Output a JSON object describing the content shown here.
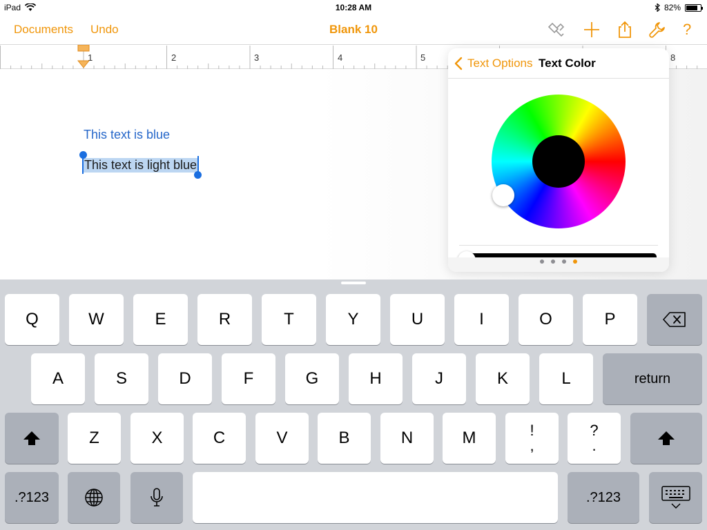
{
  "status_bar": {
    "device": "iPad",
    "time": "10:28 AM",
    "battery_percent": "82%",
    "battery_level": 0.82
  },
  "toolbar": {
    "documents_label": "Documents",
    "undo_label": "Undo",
    "title": "Blank 10",
    "icons": [
      "paintbrush-icon",
      "plus-icon",
      "share-icon",
      "wrench-icon",
      "help-icon"
    ],
    "help_glyph": "?",
    "accent_color": "#f0960a"
  },
  "ruler": {
    "numbers": [
      "1",
      "2",
      "3",
      "4",
      "5",
      "8"
    ]
  },
  "document": {
    "line1": "This text is blue",
    "line2": "This text is light blue",
    "line1_color": "#2667c9",
    "selection_color": "#bcd6f2"
  },
  "popover": {
    "back_label": "Text Options",
    "title": "Text Color",
    "page_count": 4,
    "active_page": 4
  },
  "keyboard": {
    "row1": [
      "Q",
      "W",
      "E",
      "R",
      "T",
      "Y",
      "U",
      "I",
      "O",
      "P"
    ],
    "row2": [
      "A",
      "S",
      "D",
      "F",
      "G",
      "H",
      "J",
      "K",
      "L"
    ],
    "return_label": "return",
    "row3": [
      "Z",
      "X",
      "C",
      "V",
      "B",
      "N",
      "M"
    ],
    "excl_top": "!",
    "excl_bottom": ",",
    "quest_top": "?",
    "quest_bottom": ".",
    "numbers_label": ".?123"
  }
}
